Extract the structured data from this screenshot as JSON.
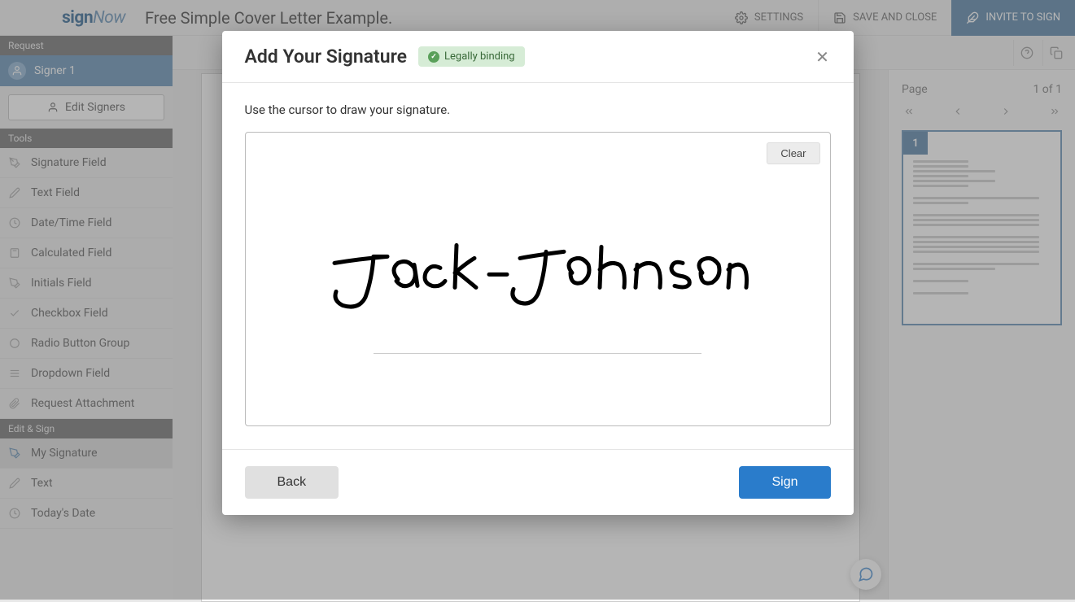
{
  "header": {
    "logo_a": "sign",
    "logo_b": "Now",
    "doc_title": "Free Simple Cover Letter Example.",
    "settings": "SETTINGS",
    "save_close": "SAVE AND CLOSE",
    "invite": "INVITE TO SIGN"
  },
  "sidebar": {
    "request_hdr": "Request",
    "signer": "Signer 1",
    "edit_signers": "Edit Signers",
    "tools_hdr": "Tools",
    "tools": [
      "Signature Field",
      "Text Field",
      "Date/Time Field",
      "Calculated Field",
      "Initials Field",
      "Checkbox Field",
      "Radio Button Group",
      "Dropdown Field",
      "Request Attachment"
    ],
    "edit_sign_hdr": "Edit & Sign",
    "edit_sign": [
      "My Signature",
      "Text",
      "Today's Date"
    ]
  },
  "right": {
    "page_label": "Page",
    "page_count": "1 of 1",
    "thumb_num": "1"
  },
  "modal": {
    "title": "Add Your Signature",
    "badge": "Legally binding",
    "instruction": "Use the cursor to draw your signature.",
    "clear": "Clear",
    "back": "Back",
    "sign": "Sign",
    "drawn_name": "Jack Johnson"
  }
}
